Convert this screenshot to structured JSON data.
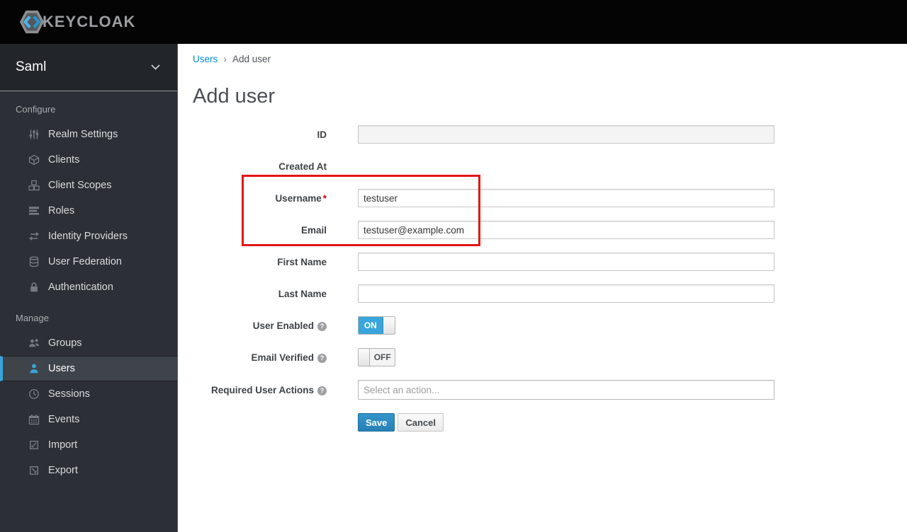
{
  "header": {
    "logo_text": "KEYCLOAK"
  },
  "sidebar": {
    "realm_selector": {
      "label": "Saml"
    },
    "sections": [
      {
        "label": "Configure",
        "items": [
          {
            "label": "Realm Settings",
            "icon": "sliders-icon"
          },
          {
            "label": "Clients",
            "icon": "cube-icon"
          },
          {
            "label": "Client Scopes",
            "icon": "cubes-icon"
          },
          {
            "label": "Roles",
            "icon": "list-icon"
          },
          {
            "label": "Identity Providers",
            "icon": "exchange-arrows-icon"
          },
          {
            "label": "User Federation",
            "icon": "database-icon"
          },
          {
            "label": "Authentication",
            "icon": "lock-icon"
          }
        ]
      },
      {
        "label": "Manage",
        "items": [
          {
            "label": "Groups",
            "icon": "groups-icon"
          },
          {
            "label": "Users",
            "icon": "user-icon",
            "active": true
          },
          {
            "label": "Sessions",
            "icon": "clock-icon"
          },
          {
            "label": "Events",
            "icon": "calendar-icon"
          },
          {
            "label": "Import",
            "icon": "import-icon"
          },
          {
            "label": "Export",
            "icon": "export-icon"
          }
        ]
      }
    ]
  },
  "breadcrumb": {
    "parent": "Users",
    "separator": "›",
    "current": "Add user"
  },
  "page_title": "Add user",
  "form": {
    "id": {
      "label": "ID",
      "value": ""
    },
    "created_at": {
      "label": "Created At"
    },
    "username": {
      "label": "Username",
      "required_marker": "*",
      "value": "testuser"
    },
    "email": {
      "label": "Email",
      "value": "testuser@example.com"
    },
    "first_name": {
      "label": "First Name",
      "value": ""
    },
    "last_name": {
      "label": "Last Name",
      "value": ""
    },
    "user_enabled": {
      "label": "User Enabled",
      "state": "ON"
    },
    "email_verified": {
      "label": "Email Verified",
      "state": "OFF"
    },
    "required_user_actions": {
      "label": "Required User Actions",
      "placeholder": "Select an action..."
    },
    "save_label": "Save",
    "cancel_label": "Cancel"
  },
  "icons": {
    "help": "?"
  },
  "colors": {
    "accent_blue": "#39a5dc",
    "link_blue": "#0088ce",
    "annotation_red": "#e51414",
    "sidebar_bg": "#2c3036",
    "header_bg": "#040404"
  }
}
